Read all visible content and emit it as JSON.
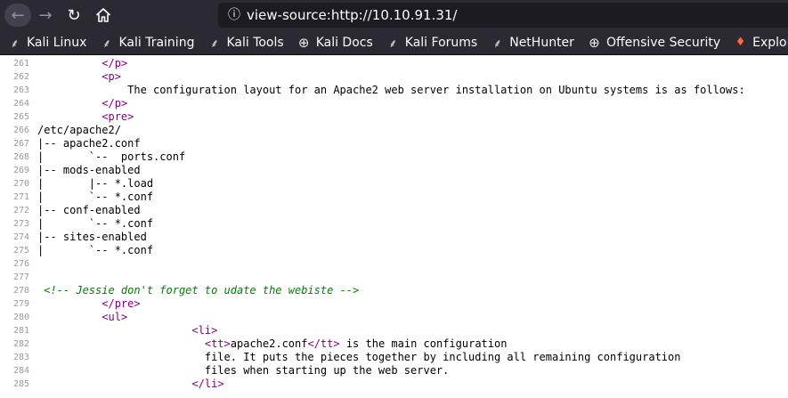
{
  "browser": {
    "url": "view-source:http://10.10.91.31/"
  },
  "bookmarks": [
    {
      "label": "Kali Linux",
      "icon": "kali-dragon-icon"
    },
    {
      "label": "Kali Training",
      "icon": "kali-dragon-icon"
    },
    {
      "label": "Kali Tools",
      "icon": "kali-dragon-icon"
    },
    {
      "label": "Kali Docs",
      "icon": "globe-icon"
    },
    {
      "label": "Kali Forums",
      "icon": "kali-dragon-icon"
    },
    {
      "label": "NetHunter",
      "icon": "kali-dragon-icon"
    },
    {
      "label": "Offensive Security",
      "icon": "globe-icon"
    },
    {
      "label": "Exploit-DB",
      "icon": "exploit-db-icon"
    }
  ],
  "source_lines": [
    {
      "num": "261",
      "indent": "          ",
      "tag": "/p"
    },
    {
      "num": "262",
      "indent": "          ",
      "tag": "p"
    },
    {
      "num": "263",
      "indent": "",
      "text": "              The configuration layout for an Apache2 web server installation on Ubuntu systems is as follows:"
    },
    {
      "num": "264",
      "indent": "          ",
      "tag": "/p"
    },
    {
      "num": "265",
      "indent": "          ",
      "tag": "pre"
    },
    {
      "num": "266",
      "indent": "",
      "text": "/etc/apache2/"
    },
    {
      "num": "267",
      "indent": "",
      "text": "|-- apache2.conf"
    },
    {
      "num": "268",
      "indent": "",
      "text": "|       `--  ports.conf"
    },
    {
      "num": "269",
      "indent": "",
      "text": "|-- mods-enabled"
    },
    {
      "num": "270",
      "indent": "",
      "text": "|       |-- *.load"
    },
    {
      "num": "271",
      "indent": "",
      "text": "|       `-- *.conf"
    },
    {
      "num": "272",
      "indent": "",
      "text": "|-- conf-enabled"
    },
    {
      "num": "273",
      "indent": "",
      "text": "|       `-- *.conf"
    },
    {
      "num": "274",
      "indent": "",
      "text": "|-- sites-enabled"
    },
    {
      "num": "275",
      "indent": "",
      "text": "|       `-- *.conf"
    },
    {
      "num": "276",
      "indent": "",
      "text": ""
    },
    {
      "num": "277",
      "indent": "",
      "text": ""
    },
    {
      "num": "278",
      "indent": "",
      "comment": " <!-- Jessie don't forget to udate the webiste -->"
    },
    {
      "num": "279",
      "indent": "          ",
      "tag": "/pre"
    },
    {
      "num": "280",
      "indent": "          ",
      "tag": "ul"
    },
    {
      "num": "281",
      "indent": "                        ",
      "tag": "li"
    },
    {
      "num": "282",
      "indent": "                          ",
      "tt": "apache2.conf",
      "text": " is the main configuration"
    },
    {
      "num": "283",
      "indent": "",
      "text": "                          file. It puts the pieces together by including all remaining configuration"
    },
    {
      "num": "284",
      "indent": "",
      "text": "                          files when starting up the web server."
    },
    {
      "num": "285",
      "indent": "                        ",
      "tag": "/li"
    }
  ]
}
